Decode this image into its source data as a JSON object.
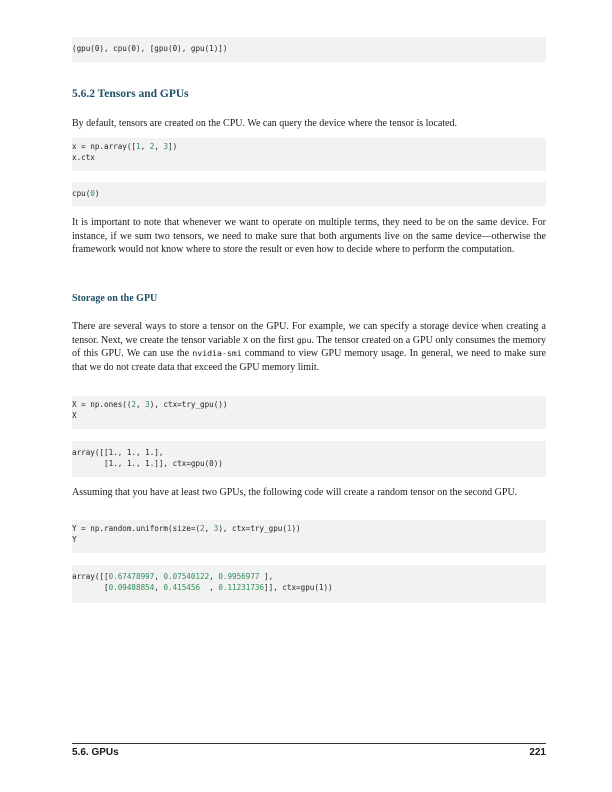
{
  "code_block_1": {
    "lines": [
      "(gpu(0), cpu(0), [gpu(0), gpu(1)])"
    ]
  },
  "section": {
    "number": "5.6.2",
    "title": "Tensors and GPUs"
  },
  "para_1": "By default, tensors are created on the CPU. We can query the device where the tensor is located.",
  "code_block_2": {
    "line_1_pre": "x = np.array([",
    "line_1_n1": "1",
    "line_1_sep1": ", ",
    "line_1_n2": "2",
    "line_1_sep2": ", ",
    "line_1_n3": "3",
    "line_1_post": "])",
    "line_2": "x.ctx"
  },
  "code_block_3": {
    "line_1_pre": "cpu(",
    "line_1_n": "0",
    "line_1_post": ")"
  },
  "para_2": "It is important to note that whenever we want to operate on multiple terms, they need to be on the same device. For instance, if we sum two tensors, we need to make sure that both arguments live on the same device—otherwise the framework would not know where to store the result or even how to decide where to perform the computation.",
  "subsection": {
    "title": "Storage on the GPU"
  },
  "para_3": {
    "part_1": "There are several ways to store a tensor on the GPU. For example, we can specify a storage device when creating a tensor. Next, we create the tensor variable ",
    "code_1": "X",
    "part_2": " on the first ",
    "code_2": "gpu",
    "part_3": ". The tensor created on a GPU only consumes the memory of this GPU. We can use the ",
    "code_3": "nvidia-smi",
    "part_4": " command to view GPU memory usage. In general, we need to make sure that we do not create data that exceed the GPU memory limit."
  },
  "code_block_4": {
    "line_1_pre": "X = np.ones((",
    "line_1_n1": "2",
    "line_1_sep": ", ",
    "line_1_n2": "3",
    "line_1_post": "), ctx=try_gpu())",
    "line_2": "X"
  },
  "code_block_5": {
    "line_1": "array([[1., 1., 1.],",
    "line_2": "       [1., 1., 1.]], ctx=gpu(0))"
  },
  "para_4": "Assuming that you have at least two GPUs, the following code will create a random tensor on the second GPU.",
  "code_block_6": {
    "line_1_pre": "Y = np.random.uniform(size=(",
    "line_1_n1": "2",
    "line_1_sep": ", ",
    "line_1_n2": "3",
    "line_1_mid": "), ctx=try_gpu(",
    "line_1_n3": "1",
    "line_1_post": "))",
    "line_2": "Y"
  },
  "code_block_7": {
    "line_1_pre": "array([[",
    "line_1_v1": "0.67478997",
    "line_1_v2": "0.07540122",
    "line_1_v3": "0.9956977",
    "line_1_post": " ],",
    "line_2_pre": "       [",
    "line_2_v1": "0.09488854",
    "line_2_v2": "0.415456",
    "line_2_v3": "0.11231736",
    "line_2_post": "]], ctx=gpu(1))"
  },
  "footer": {
    "section_label": "5.6. GPUs",
    "page_number": "221"
  }
}
